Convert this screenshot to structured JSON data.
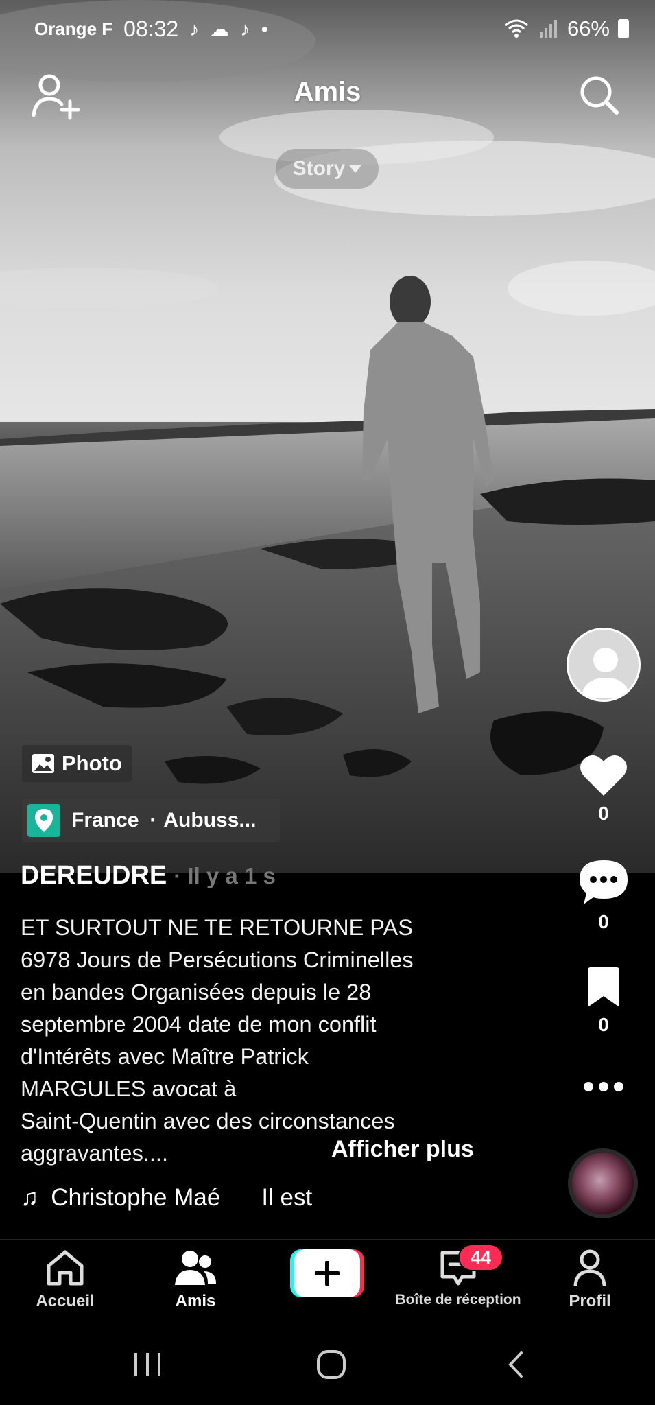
{
  "status_bar": {
    "carrier": "Orange F",
    "time": "08:32",
    "battery": "66%"
  },
  "header": {
    "title": "Amis",
    "story_label": "Story"
  },
  "post": {
    "type_tag": "Photo",
    "location_country": "France",
    "location_separator": "·",
    "location_place": "Aubuss...",
    "author": "DEREUDRE",
    "time_ago": "· Il y a 1 s",
    "caption_lines": [
      "ET SURTOUT NE TE RETOURNE PAS",
      "6978 Jours de Persécutions Criminelles",
      "en bandes Organisées depuis le 28",
      "septembre 2004 date de mon conflit",
      "d'Intérêts avec Maître Patrick",
      "MARGULES avocat à",
      "Saint-Quentin avec des circonstances",
      "aggravantes...."
    ],
    "show_more": "Afficher plus",
    "music_artist": "Christophe Maé",
    "music_title": "Il est",
    "likes": "0",
    "comments": "0",
    "saves": "0"
  },
  "bottom_nav": {
    "items": [
      {
        "label": "Accueil"
      },
      {
        "label": "Amis"
      },
      {
        "label": "Boîte de réception"
      },
      {
        "label": "Profil"
      }
    ],
    "inbox_badge": "44"
  },
  "colors": {
    "accent_red": "#fe2c55",
    "accent_cyan": "#25f4ee",
    "location_green": "#19b59b"
  }
}
